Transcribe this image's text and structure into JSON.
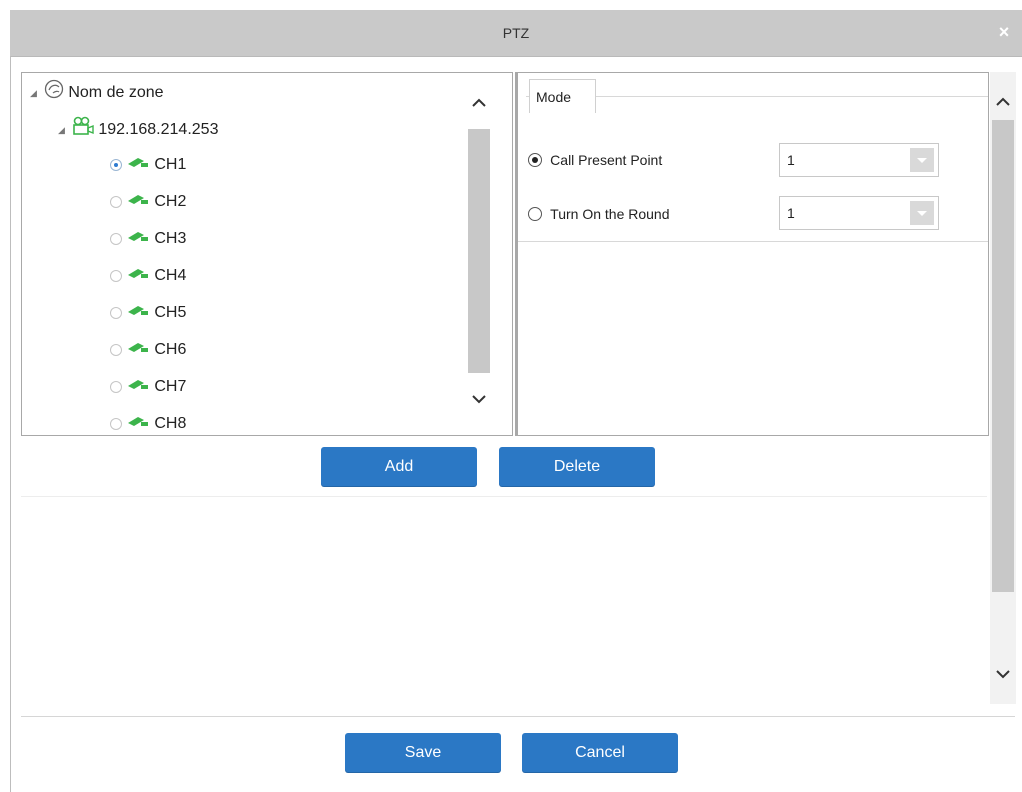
{
  "dialog": {
    "title": "PTZ",
    "close_symbol": "×"
  },
  "tree": {
    "zone": "Nom de zone",
    "device": "192.168.214.253",
    "channels": [
      {
        "label": "CH1",
        "selected": true
      },
      {
        "label": "CH2",
        "selected": false
      },
      {
        "label": "CH3",
        "selected": false
      },
      {
        "label": "CH4",
        "selected": false
      },
      {
        "label": "CH5",
        "selected": false
      },
      {
        "label": "CH6",
        "selected": false
      },
      {
        "label": "CH7",
        "selected": false
      },
      {
        "label": "CH8",
        "selected": false
      }
    ]
  },
  "mode": {
    "legend": "Mode",
    "options": [
      {
        "label": "Call Present Point",
        "value": "1",
        "selected": true
      },
      {
        "label": "Turn On the Round",
        "value": "1",
        "selected": false
      }
    ]
  },
  "actions": {
    "add": "Add",
    "delete": "Delete"
  },
  "footer": {
    "save": "Save",
    "cancel": "Cancel"
  },
  "colors": {
    "accent": "#2b78c5",
    "icon_green": "#3cb44b",
    "titlebar": "#c9c9c9"
  }
}
